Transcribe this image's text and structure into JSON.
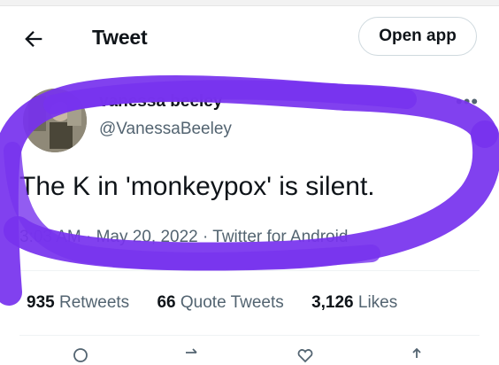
{
  "header": {
    "title": "Tweet",
    "open_app_label": "Open app",
    "back_icon": "arrow-left-icon"
  },
  "tweet": {
    "author_name": "vanessa beeley",
    "author_handle": "@VanessaBeeley",
    "text": "The K in 'monkeypox' is silent.",
    "timestamp": "3:03 AM · May 20, 2022 · Twitter for Android"
  },
  "stats": [
    {
      "count": "935",
      "label": "Retweets"
    },
    {
      "count": "66",
      "label": "Quote Tweets"
    },
    {
      "count": "3,126",
      "label": "Likes"
    }
  ],
  "colors": {
    "marker": "#7733ee",
    "muted_text": "#536471",
    "primary_text": "#0f1419"
  }
}
